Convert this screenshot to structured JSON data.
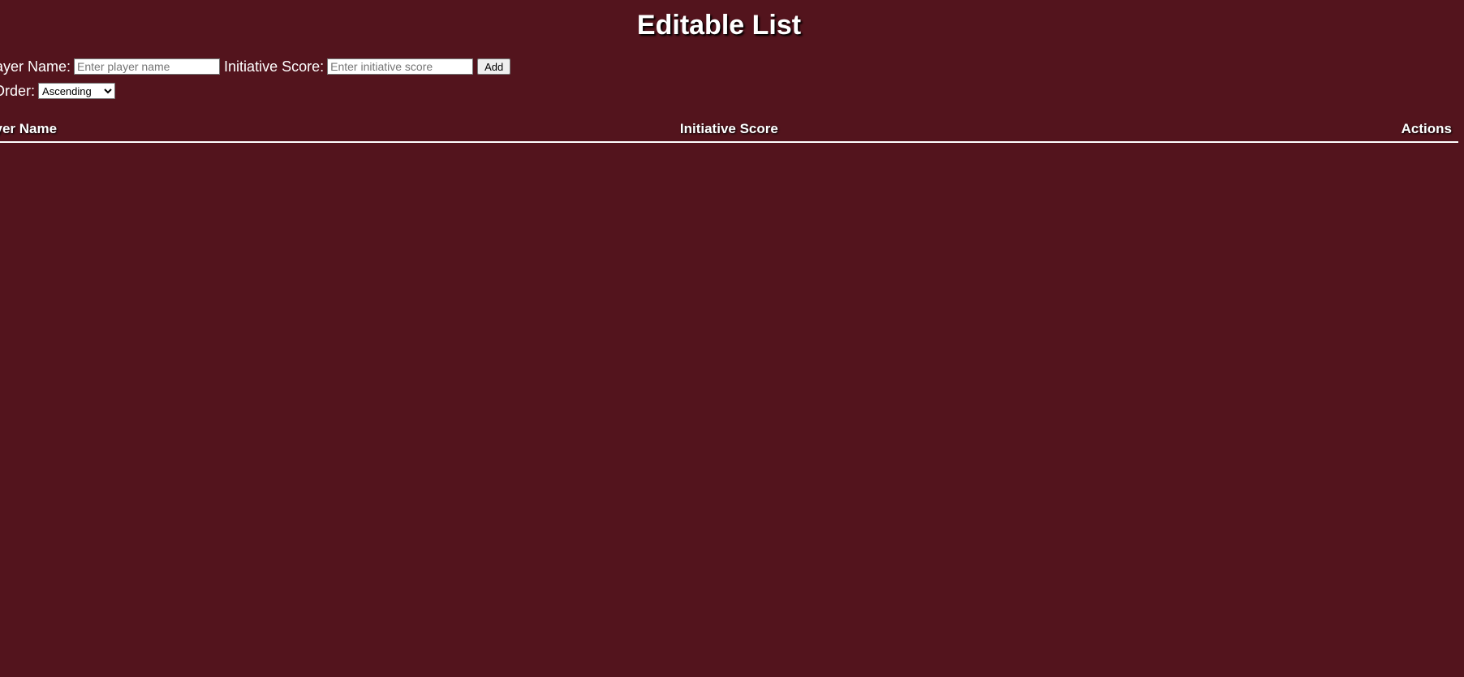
{
  "page": {
    "title": "Editable List",
    "background_color": "#53141d",
    "text_color": "#ffffff"
  },
  "form": {
    "player_label": "Player Name:",
    "player_placeholder": "Enter player name",
    "player_value": "",
    "initiative_label": "Initiative Score:",
    "initiative_placeholder": "Enter initiative score",
    "initiative_value": "",
    "add_label": "Add"
  },
  "sort": {
    "label": "Sort Order:",
    "selected": "Ascending"
  },
  "table": {
    "columns": [
      "Player Name",
      "Initiative Score",
      "Actions"
    ],
    "rows": []
  }
}
